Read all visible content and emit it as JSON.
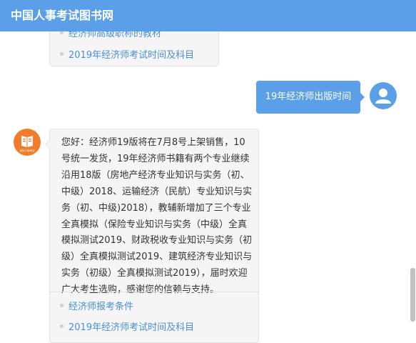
{
  "header": {
    "title": "中国人事考试图书网"
  },
  "top_bubble": {
    "links": [
      {
        "label": "经济师高级职称的教材"
      },
      {
        "label": "2019年经济师考试时间及科目"
      }
    ]
  },
  "user_message": {
    "text": "19年经济师出版时间"
  },
  "bot_reply": {
    "avatar_caption": "无忧人事考试",
    "text": "您好：经济师19版将在7月8号上架销售，10号统一发货，19年经济师书籍有两个专业继续沿用18版（房地产经济专业知识与实务（初、中级）2018、运输经济（民航）专业知识与实务（初、中级)2018），教辅新增加了三个专业全真模拟（保险专业知识与实务（中级）全真模拟测试2019、财政税收专业知识与实务（初级）全真模拟测试2019、建筑经济专业知识与实务（初级）全真模拟测试2019），届时欢迎广大考生选购，感谢您的信赖与支持。",
    "links": [
      {
        "label": "经济师报考条件"
      },
      {
        "label": "2019年经济师考试时间及科目"
      }
    ]
  },
  "colors": {
    "header": "#5a9fe8",
    "user_bubble": "#5a9fe8",
    "link": "#4a8fd6",
    "bot_avatar": "#f07c2c",
    "bubble_bg": "#f5f5f5"
  }
}
